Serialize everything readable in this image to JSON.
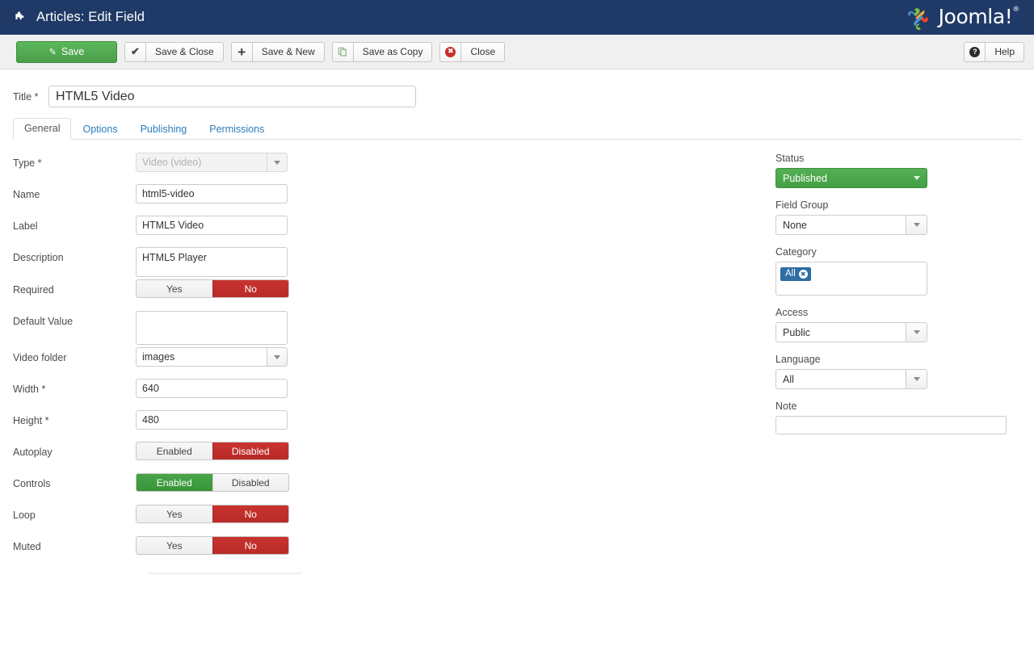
{
  "header": {
    "title": "Articles: Edit Field",
    "icon": "puzzle-piece-icon",
    "brand_text": "Joomla!",
    "brand_sup": "®",
    "bg_color": "#1f3a66"
  },
  "toolbar": {
    "save_label": "Save",
    "save_icon": "pencil-square-icon",
    "save_close_label": "Save & Close",
    "save_close_icon": "check-icon",
    "save_new_label": "Save & New",
    "save_new_icon": "plus-icon",
    "save_copy_label": "Save as Copy",
    "save_copy_icon": "copy-icon",
    "close_label": "Close",
    "close_icon": "x-circle-icon",
    "help_label": "Help",
    "help_icon": "question-circle-icon",
    "accent_green": "#4a9e4a",
    "accent_red": "#c62d2d"
  },
  "title_field": {
    "label": "Title",
    "required_mark": "*",
    "value": "HTML5 Video",
    "placeholder": ""
  },
  "tabs": [
    {
      "label": "General",
      "active": true
    },
    {
      "label": "Options",
      "active": false
    },
    {
      "label": "Publishing",
      "active": false
    },
    {
      "label": "Permissions",
      "active": false
    }
  ],
  "main": {
    "fields": [
      {
        "label": "Type",
        "required": "*",
        "kind": "select-disabled",
        "value": "Video (video)"
      },
      {
        "label": "Name",
        "required": "",
        "kind": "input",
        "value": "html5-video"
      },
      {
        "label": "Label",
        "required": "",
        "kind": "input",
        "value": "HTML5 Video"
      },
      {
        "label": "Description",
        "required": "",
        "kind": "textarea",
        "value": "HTML5 Player"
      },
      {
        "label": "Required",
        "required": "",
        "kind": "toggle",
        "options": [
          "Yes",
          "No"
        ],
        "selected": "No",
        "selected_color": "red"
      },
      {
        "label": "Default Value",
        "required": "",
        "kind": "textarea",
        "value": ""
      },
      {
        "label": "Video folder",
        "required": "",
        "kind": "select",
        "value": "images"
      },
      {
        "label": "Width",
        "required": "*",
        "kind": "input",
        "value": "640"
      },
      {
        "label": "Height",
        "required": "*",
        "kind": "input",
        "value": "480"
      },
      {
        "label": "Autoplay",
        "required": "",
        "kind": "toggle",
        "options": [
          "Enabled",
          "Disabled"
        ],
        "selected": "Disabled",
        "selected_color": "red"
      },
      {
        "label": "Controls",
        "required": "",
        "kind": "toggle",
        "options": [
          "Enabled",
          "Disabled"
        ],
        "selected": "Enabled",
        "selected_color": "green"
      },
      {
        "label": "Loop",
        "required": "",
        "kind": "toggle",
        "options": [
          "Yes",
          "No"
        ],
        "selected": "No",
        "selected_color": "red"
      },
      {
        "label": "Muted",
        "required": "",
        "kind": "toggle",
        "options": [
          "Yes",
          "No"
        ],
        "selected": "No",
        "selected_color": "red"
      }
    ]
  },
  "sidebar": {
    "status": {
      "label": "Status",
      "value": "Published",
      "color": "#45a045"
    },
    "field_group": {
      "label": "Field Group",
      "value": "None"
    },
    "category": {
      "label": "Category",
      "chips": [
        "All"
      ],
      "chip_remove_icon": "remove-circle-icon"
    },
    "access": {
      "label": "Access",
      "value": "Public"
    },
    "language": {
      "label": "Language",
      "value": "All"
    },
    "note": {
      "label": "Note",
      "value": "",
      "placeholder": ""
    }
  }
}
